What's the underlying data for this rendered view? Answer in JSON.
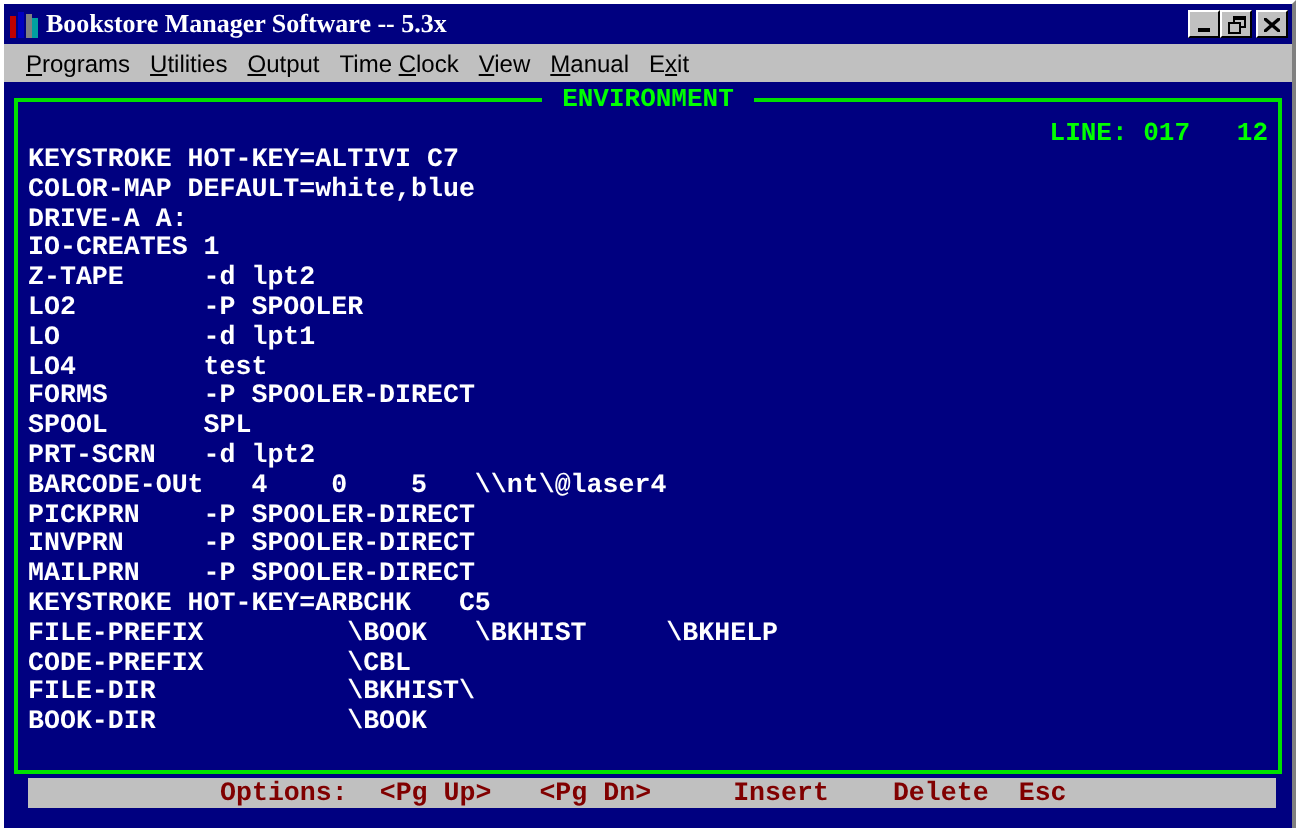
{
  "window": {
    "title": "Bookstore Manager Software -- 5.3x"
  },
  "menu": [
    {
      "key": "P",
      "after": "rograms"
    },
    {
      "key": "U",
      "after": "tilities"
    },
    {
      "key": "O",
      "after": "utput"
    },
    {
      "before": "Time ",
      "key": "C",
      "after": "lock"
    },
    {
      "key": "V",
      "after": "iew"
    },
    {
      "key": "M",
      "after": "anual"
    },
    {
      "before": "E",
      "key": "x",
      "after": "it"
    }
  ],
  "panel": {
    "title": "ENVIRONMENT",
    "line_indicator": "LINE: 017   12",
    "lines": [
      "KEYSTROKE HOT-KEY=ALTIVI C7",
      "COLOR-MAP DEFAULT=white,blue",
      "DRIVE-A A:",
      "IO-CREATES 1",
      "Z-TAPE     -d lpt2",
      "LO2        -P SPOOLER",
      "LO         -d lpt1",
      "LO4        test",
      "FORMS      -P SPOOLER-DIRECT",
      "SPOOL      SPL",
      "PRT-SCRN   -d lpt2",
      "BARCODE-OUt   4    0    5   \\\\nt\\@laser4",
      "PICKPRN    -P SPOOLER-DIRECT",
      "INVPRN     -P SPOOLER-DIRECT",
      "MAILPRN    -P SPOOLER-DIRECT",
      "KEYSTROKE HOT-KEY=ARBCHK   C5",
      "FILE-PREFIX         \\BOOK   \\BKHIST     \\BKHELP",
      "CODE-PREFIX         \\CBL",
      "FILE-DIR            \\BKHIST\\",
      "BOOK-DIR            \\BOOK"
    ]
  },
  "options_bar": [
    "Options:",
    "<Pg Up>",
    "<Pg Dn>",
    "Insert",
    "Delete",
    "Esc"
  ]
}
